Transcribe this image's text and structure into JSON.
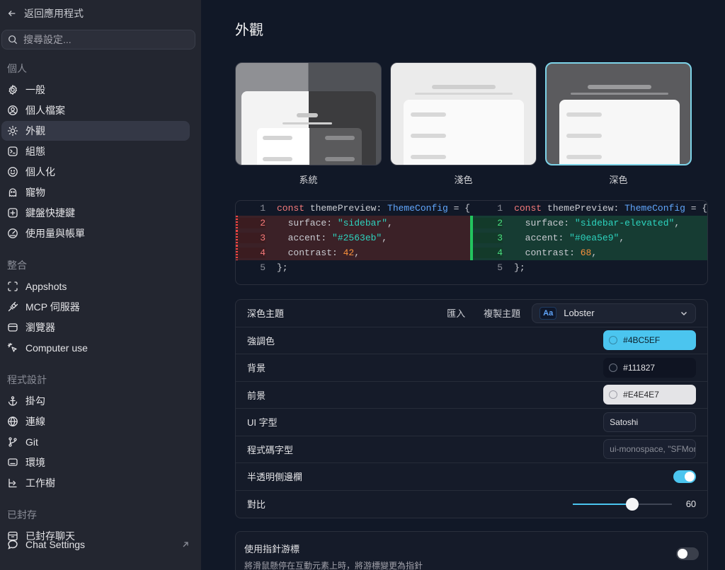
{
  "sidebar": {
    "back_label": "返回應用程式",
    "search_placeholder": "搜尋設定...",
    "groups": [
      {
        "label": "個人",
        "items": [
          {
            "label": "一般",
            "icon": "gear-icon"
          },
          {
            "label": "個人檔案",
            "icon": "user-circle-icon"
          },
          {
            "label": "外觀",
            "icon": "sun-icon",
            "active": true
          },
          {
            "label": "組態",
            "icon": "terminal-icon"
          },
          {
            "label": "個人化",
            "icon": "smile-icon"
          },
          {
            "label": "寵物",
            "icon": "ghost-icon"
          },
          {
            "label": "鍵盤快捷鍵",
            "icon": "keyboard-icon"
          },
          {
            "label": "使用量與帳單",
            "icon": "gauge-icon"
          }
        ]
      },
      {
        "label": "整合",
        "items": [
          {
            "label": "Appshots",
            "icon": "capture-icon"
          },
          {
            "label": "MCP 伺服器",
            "icon": "plug-icon"
          },
          {
            "label": "瀏覽器",
            "icon": "browser-icon"
          },
          {
            "label": "Computer use",
            "icon": "cursor-click-icon"
          }
        ]
      },
      {
        "label": "程式設計",
        "items": [
          {
            "label": "掛勾",
            "icon": "anchor-icon"
          },
          {
            "label": "連線",
            "icon": "globe-icon"
          },
          {
            "label": "Git",
            "icon": "git-branch-icon"
          },
          {
            "label": "環境",
            "icon": "monitor-icon"
          },
          {
            "label": "工作樹",
            "icon": "worktree-icon"
          }
        ]
      },
      {
        "label": "已封存",
        "items": [
          {
            "label": "已封存聊天",
            "icon": "archive-icon"
          }
        ]
      }
    ],
    "chat_settings_label": "Chat Settings"
  },
  "main": {
    "title": "外觀",
    "themes": [
      {
        "label": "系統",
        "selected": false
      },
      {
        "label": "淺色",
        "selected": false
      },
      {
        "label": "深色",
        "selected": true
      }
    ],
    "diff": {
      "left": [
        {
          "n": "1",
          "parts": [
            [
              "kw",
              "const "
            ],
            [
              "",
              "themePreview: "
            ],
            [
              "ty",
              "ThemeConfig"
            ],
            [
              "",
              " = {"
            ]
          ]
        },
        {
          "n": "2",
          "chg": true,
          "parts": [
            [
              "",
              "  surface: "
            ],
            [
              "str",
              "\"sidebar\""
            ],
            [
              "",
              ","
            ]
          ]
        },
        {
          "n": "3",
          "chg": true,
          "parts": [
            [
              "",
              "  accent: "
            ],
            [
              "str",
              "\"#2563eb\""
            ],
            [
              "",
              ","
            ]
          ]
        },
        {
          "n": "4",
          "chg": true,
          "parts": [
            [
              "",
              "  contrast: "
            ],
            [
              "num",
              "42"
            ],
            [
              "",
              ","
            ]
          ]
        },
        {
          "n": "5",
          "parts": [
            [
              "",
              "};"
            ]
          ]
        }
      ],
      "right": [
        {
          "n": "1",
          "parts": [
            [
              "kw",
              "const "
            ],
            [
              "",
              "themePreview: "
            ],
            [
              "ty",
              "ThemeConfig"
            ],
            [
              "",
              " = {"
            ]
          ]
        },
        {
          "n": "2",
          "chg": true,
          "parts": [
            [
              "",
              "  surface: "
            ],
            [
              "str",
              "\"sidebar-elevated\""
            ],
            [
              "",
              ","
            ]
          ]
        },
        {
          "n": "3",
          "chg": true,
          "parts": [
            [
              "",
              "  accent: "
            ],
            [
              "str",
              "\"#0ea5e9\""
            ],
            [
              "",
              ","
            ]
          ]
        },
        {
          "n": "4",
          "chg": true,
          "parts": [
            [
              "",
              "  contrast: "
            ],
            [
              "num",
              "68"
            ],
            [
              "",
              ","
            ]
          ]
        },
        {
          "n": "5",
          "parts": [
            [
              "",
              "};"
            ]
          ]
        }
      ]
    },
    "settings": {
      "dark_theme_label": "深色主題",
      "import_label": "匯入",
      "copy_theme_label": "複製主題",
      "theme_select_badge": "Aa",
      "theme_select_value": "Lobster",
      "accent_label": "強調色",
      "accent_value": "#4BC5EF",
      "background_label": "背景",
      "background_value": "#111827",
      "foreground_label": "前景",
      "foreground_value": "#E4E4E7",
      "ui_font_label": "UI 字型",
      "ui_font_value": "Satoshi",
      "code_font_label": "程式碼字型",
      "code_font_placeholder": "ui-monospace, \"SFMono-Regular\"",
      "translucent_sidebar_label": "半透明側邊欄",
      "translucent_sidebar_on": true,
      "contrast_label": "對比",
      "contrast_value": "60",
      "contrast_max": 100
    },
    "pointer": {
      "title": "使用指針游標",
      "description": "將滑鼠懸停在互動元素上時，將游標變更為指針",
      "on": false
    }
  },
  "colors": {
    "accent": "#4BC5EF",
    "background": "#111827",
    "foreground": "#E4E4E7"
  }
}
